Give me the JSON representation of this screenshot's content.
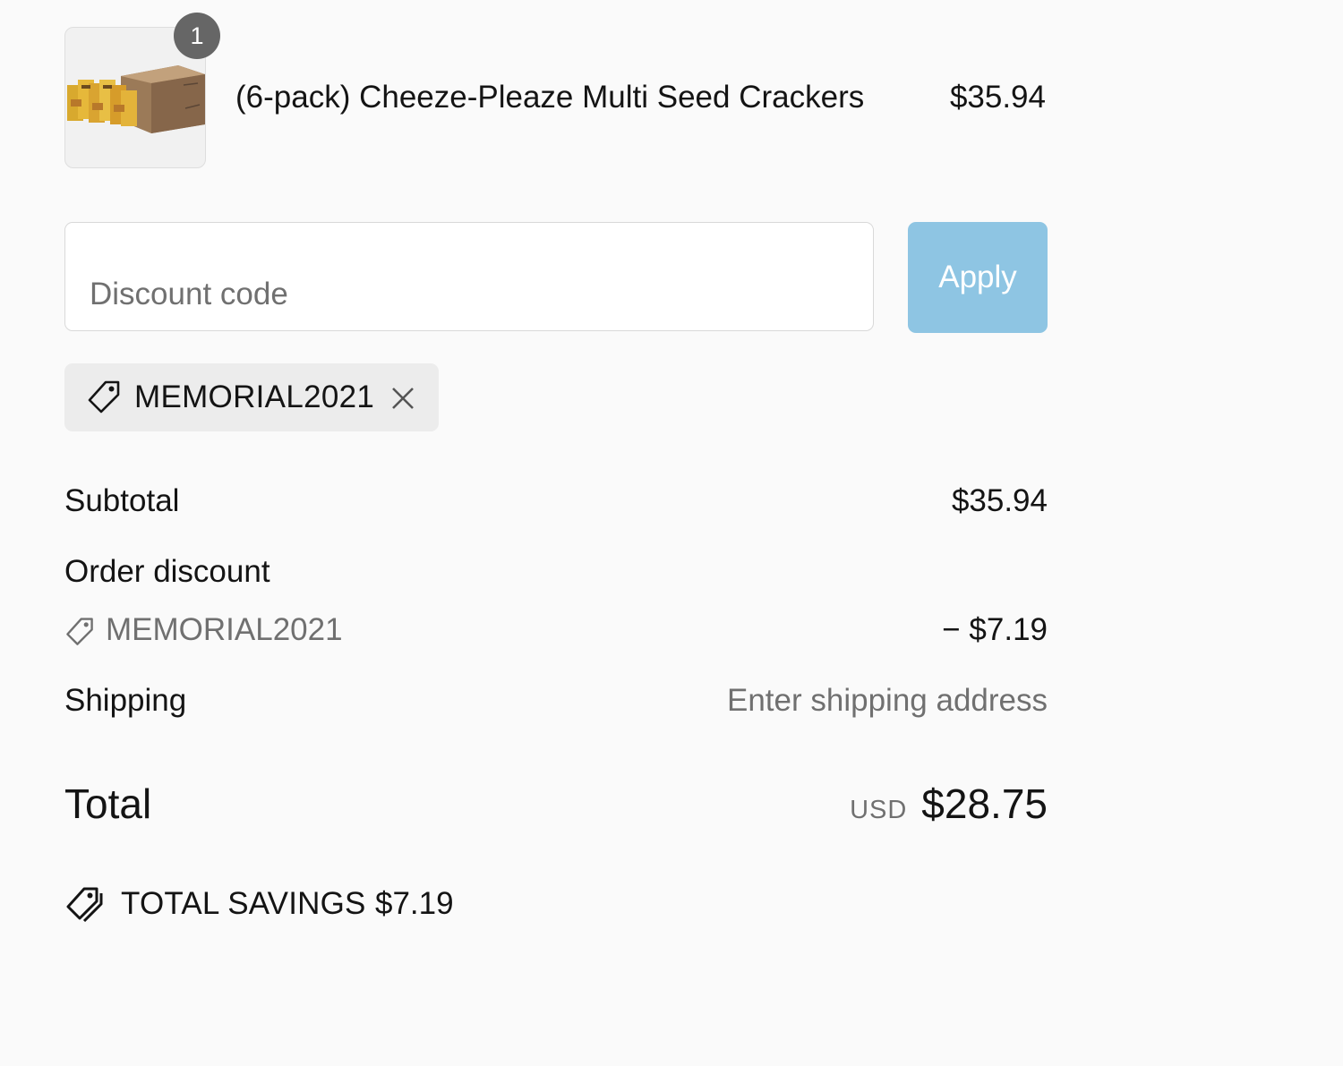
{
  "cart": {
    "items": [
      {
        "quantity": "1",
        "name": "(6-pack) Cheeze-Pleaze Multi Seed Crackers",
        "price": "$35.94"
      }
    ]
  },
  "discount": {
    "placeholder": "Discount code",
    "value": "",
    "apply_label": "Apply",
    "applied_code": "MEMORIAL2021"
  },
  "summary": {
    "subtotal_label": "Subtotal",
    "subtotal_value": "$35.94",
    "order_discount_label": "Order discount",
    "order_discount_code": "MEMORIAL2021",
    "order_discount_value": "− $7.19",
    "shipping_label": "Shipping",
    "shipping_value": "Enter shipping address",
    "total_label": "Total",
    "currency": "USD",
    "total_value": "$28.75",
    "savings_label": "TOTAL SAVINGS",
    "savings_value": "$7.19"
  },
  "colors": {
    "background": "#fafafa",
    "apply_button": "#8ec5e3",
    "badge": "#666666",
    "muted_text": "#707070"
  },
  "icons": [
    "product-thumbnail",
    "tag-icon",
    "close-icon",
    "tags-icon"
  ]
}
